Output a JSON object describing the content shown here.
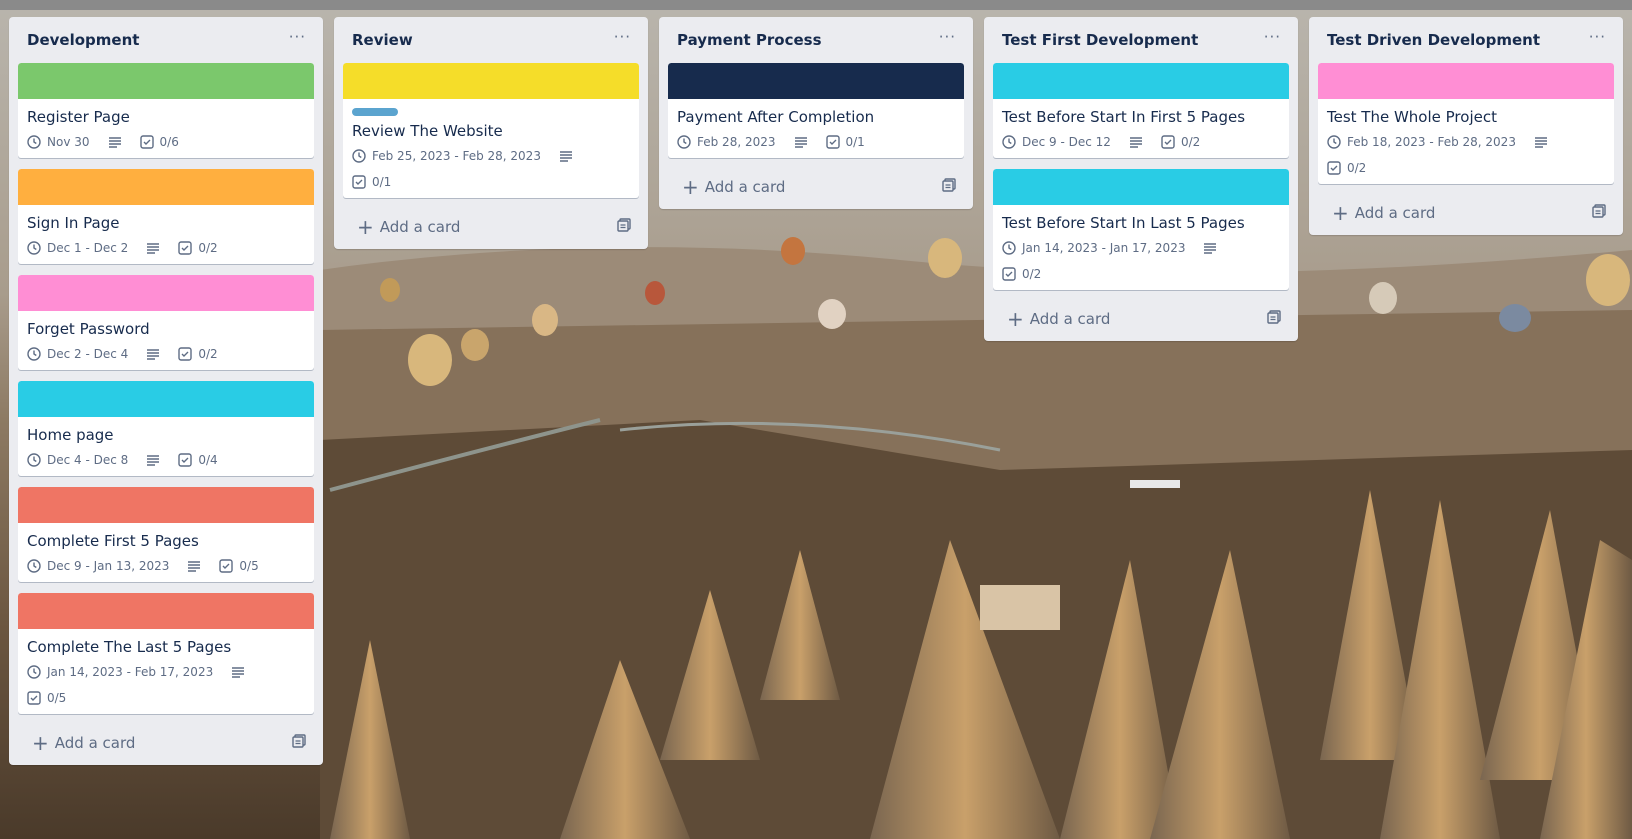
{
  "colors": {
    "green": "#7bc86c",
    "orange": "#ffaf3f",
    "pink": "#ff8ed4",
    "sky": "#29cce5",
    "red": "#ef7564",
    "yellow": "#f5dd29",
    "navy": "#172b4d",
    "blue_chip": "#5ba4cf"
  },
  "lists": [
    {
      "title": "Development",
      "menu": "···",
      "add_card": "Add a card",
      "cards": [
        {
          "title": "Register Page",
          "date": "Nov 30",
          "checklist": "0/6",
          "cover": "#7bc86c"
        },
        {
          "title": "Sign In Page",
          "date": "Dec 1 - Dec 2",
          "checklist": "0/2",
          "cover": "#ffaf3f"
        },
        {
          "title": "Forget Password",
          "date": "Dec 2 - Dec 4",
          "checklist": "0/2",
          "cover": "#ff8ed4"
        },
        {
          "title": "Home page",
          "date": "Dec 4 - Dec 8",
          "checklist": "0/4",
          "cover": "#29cce5"
        },
        {
          "title": "Complete First 5 Pages",
          "date": "Dec 9 - Jan 13, 2023",
          "checklist": "0/5",
          "cover": "#ef7564"
        },
        {
          "title": "Complete The Last 5 Pages",
          "date": "Jan 14, 2023 - Feb 17, 2023",
          "checklist": "0/5",
          "cover": "#ef7564"
        }
      ]
    },
    {
      "title": "Review",
      "menu": "···",
      "add_card": "Add a card",
      "cards": [
        {
          "title": "Review The Website",
          "date": "Feb 25, 2023 - Feb 28, 2023",
          "checklist": "0/1",
          "cover": "#f5dd29",
          "label": "#5ba4cf"
        }
      ]
    },
    {
      "title": "Payment Process",
      "menu": "···",
      "add_card": "Add a card",
      "cards": [
        {
          "title": "Payment After Completion",
          "date": "Feb 28, 2023",
          "checklist": "0/1",
          "cover": "#172b4d"
        }
      ]
    },
    {
      "title": "Test First Development",
      "menu": "···",
      "add_card": "Add a card",
      "cards": [
        {
          "title": "Test Before Start In First 5 Pages",
          "date": "Dec 9 - Dec 12",
          "checklist": "0/2",
          "cover": "#29cce5"
        },
        {
          "title": "Test Before Start In Last 5 Pages",
          "date": "Jan 14, 2023 - Jan 17, 2023",
          "checklist": "0/2",
          "cover": "#29cce5"
        }
      ]
    },
    {
      "title": "Test Driven Development",
      "menu": "···",
      "add_card": "Add a card",
      "cards": [
        {
          "title": "Test The Whole Project",
          "date": "Feb 18, 2023 - Feb 28, 2023",
          "checklist": "0/2",
          "cover": "#ff8ed4"
        }
      ]
    }
  ]
}
